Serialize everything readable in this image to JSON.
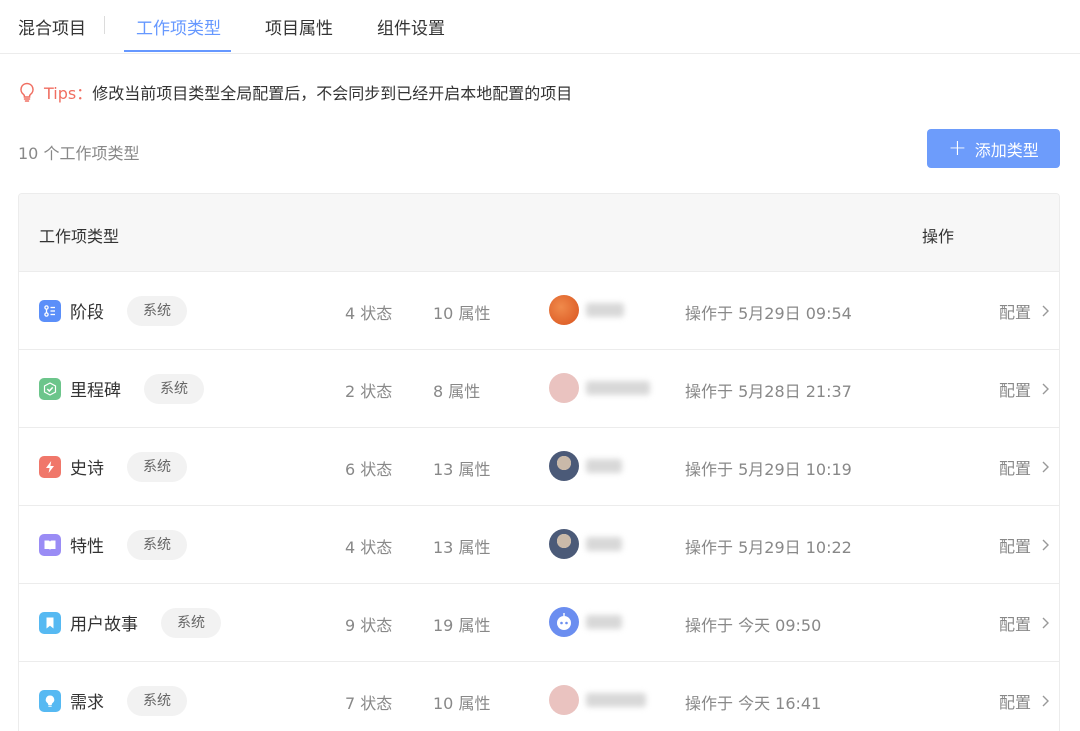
{
  "tabs": [
    {
      "label": "混合项目",
      "active": false
    },
    {
      "label": "工作项类型",
      "active": true
    },
    {
      "label": "项目属性",
      "active": false
    },
    {
      "label": "组件设置",
      "active": false
    }
  ],
  "tips": {
    "label": "Tips：",
    "text": "修改当前项目类型全局配置后，不会同步到已经开启本地配置的项目"
  },
  "summary": {
    "count_text": "10 个工作项类型"
  },
  "add_button": {
    "label": "添加类型"
  },
  "table": {
    "headers": {
      "type": "工作项类型",
      "action": "操作"
    },
    "rows": [
      {
        "name": "阶段",
        "badge": "系统",
        "states": "4 状态",
        "attrs": "10 属性",
        "time": "操作于 5月29日 09:54",
        "action": "配置",
        "icon": "stage-icon",
        "icon_color": "#5b8ff9"
      },
      {
        "name": "里程碑",
        "badge": "系统",
        "states": "2 状态",
        "attrs": "8 属性",
        "time": "操作于 5月28日 21:37",
        "action": "配置",
        "icon": "milestone-check-icon",
        "icon_color": "#6cc58b"
      },
      {
        "name": "史诗",
        "badge": "系统",
        "states": "6 状态",
        "attrs": "13 属性",
        "time": "操作于 5月29日 10:19",
        "action": "配置",
        "icon": "epic-lightning-icon",
        "icon_color": "#f0776a"
      },
      {
        "name": "特性",
        "badge": "系统",
        "states": "4 状态",
        "attrs": "13 属性",
        "time": "操作于 5月29日 10:22",
        "action": "配置",
        "icon": "feature-book-icon",
        "icon_color": "#9a8cf5"
      },
      {
        "name": "用户故事",
        "badge": "系统",
        "states": "9 状态",
        "attrs": "19 属性",
        "time": "操作于 今天 09:50",
        "action": "配置",
        "icon": "story-bookmark-icon",
        "icon_color": "#56b9f2"
      },
      {
        "name": "需求",
        "badge": "系统",
        "states": "7 状态",
        "attrs": "10 属性",
        "time": "操作于 今天 16:41",
        "action": "配置",
        "icon": "requirement-bulb-icon",
        "icon_color": "#56b9f2"
      }
    ]
  },
  "colors": {
    "accent": "#6698ff",
    "button": "#6d9cfb",
    "tips": "#f06e61"
  }
}
